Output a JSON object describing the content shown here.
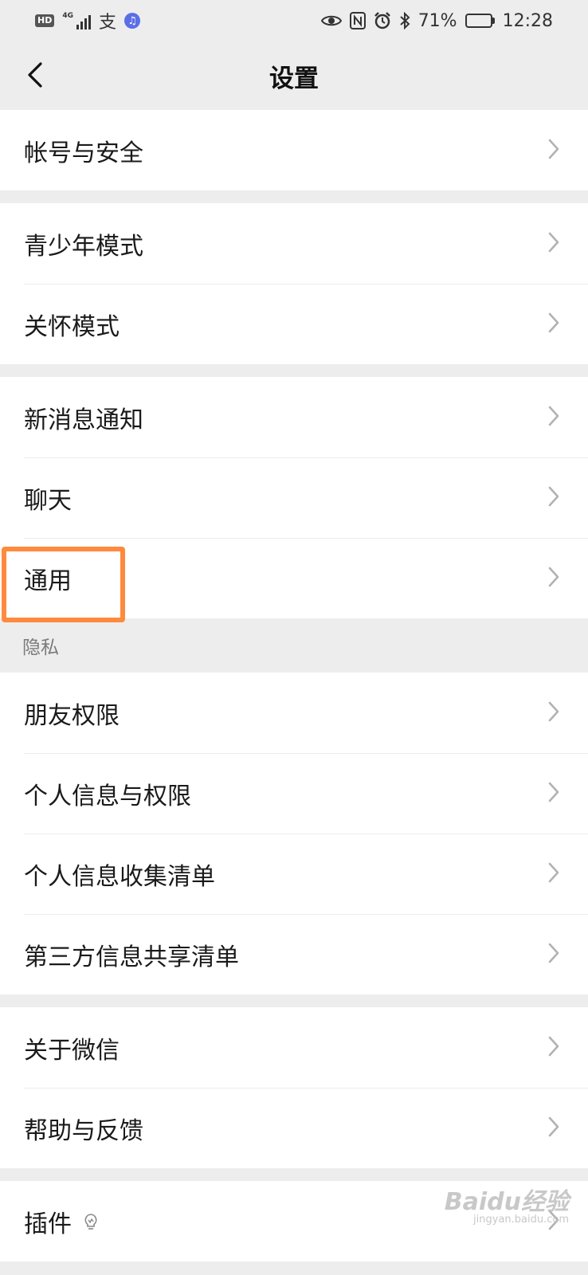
{
  "status_bar": {
    "hd_badge": "HD",
    "network": "4G",
    "alipay_glyph": "支",
    "music_glyph": "♫",
    "battery": "71%",
    "battery_level": 0.71,
    "time": "12:28"
  },
  "nav": {
    "title": "设置",
    "back_icon": "chevron-left-icon"
  },
  "groups": [
    {
      "items": [
        {
          "label": "帐号与安全"
        }
      ]
    },
    {
      "items": [
        {
          "label": "青少年模式"
        },
        {
          "label": "关怀模式"
        }
      ]
    },
    {
      "items": [
        {
          "label": "新消息通知"
        },
        {
          "label": "聊天"
        },
        {
          "label": "通用"
        }
      ]
    },
    {
      "header": "隐私",
      "items": [
        {
          "label": "朋友权限"
        },
        {
          "label": "个人信息与权限"
        },
        {
          "label": "个人信息收集清单"
        },
        {
          "label": "第三方信息共享清单"
        }
      ]
    },
    {
      "items": [
        {
          "label": "关于微信"
        },
        {
          "label": "帮助与反馈"
        }
      ]
    },
    {
      "items": [
        {
          "label": "插件"
        }
      ]
    }
  ],
  "annotation": {
    "highlighted_item": "通用",
    "color": "#ff8a3d"
  },
  "watermark": {
    "brand": "Baidu经验",
    "url": "jingyan.baidu.com"
  },
  "colors": {
    "background": "#ededed",
    "card": "#ffffff",
    "text": "#1a1a1a",
    "chevron": "#b2b2b2"
  }
}
